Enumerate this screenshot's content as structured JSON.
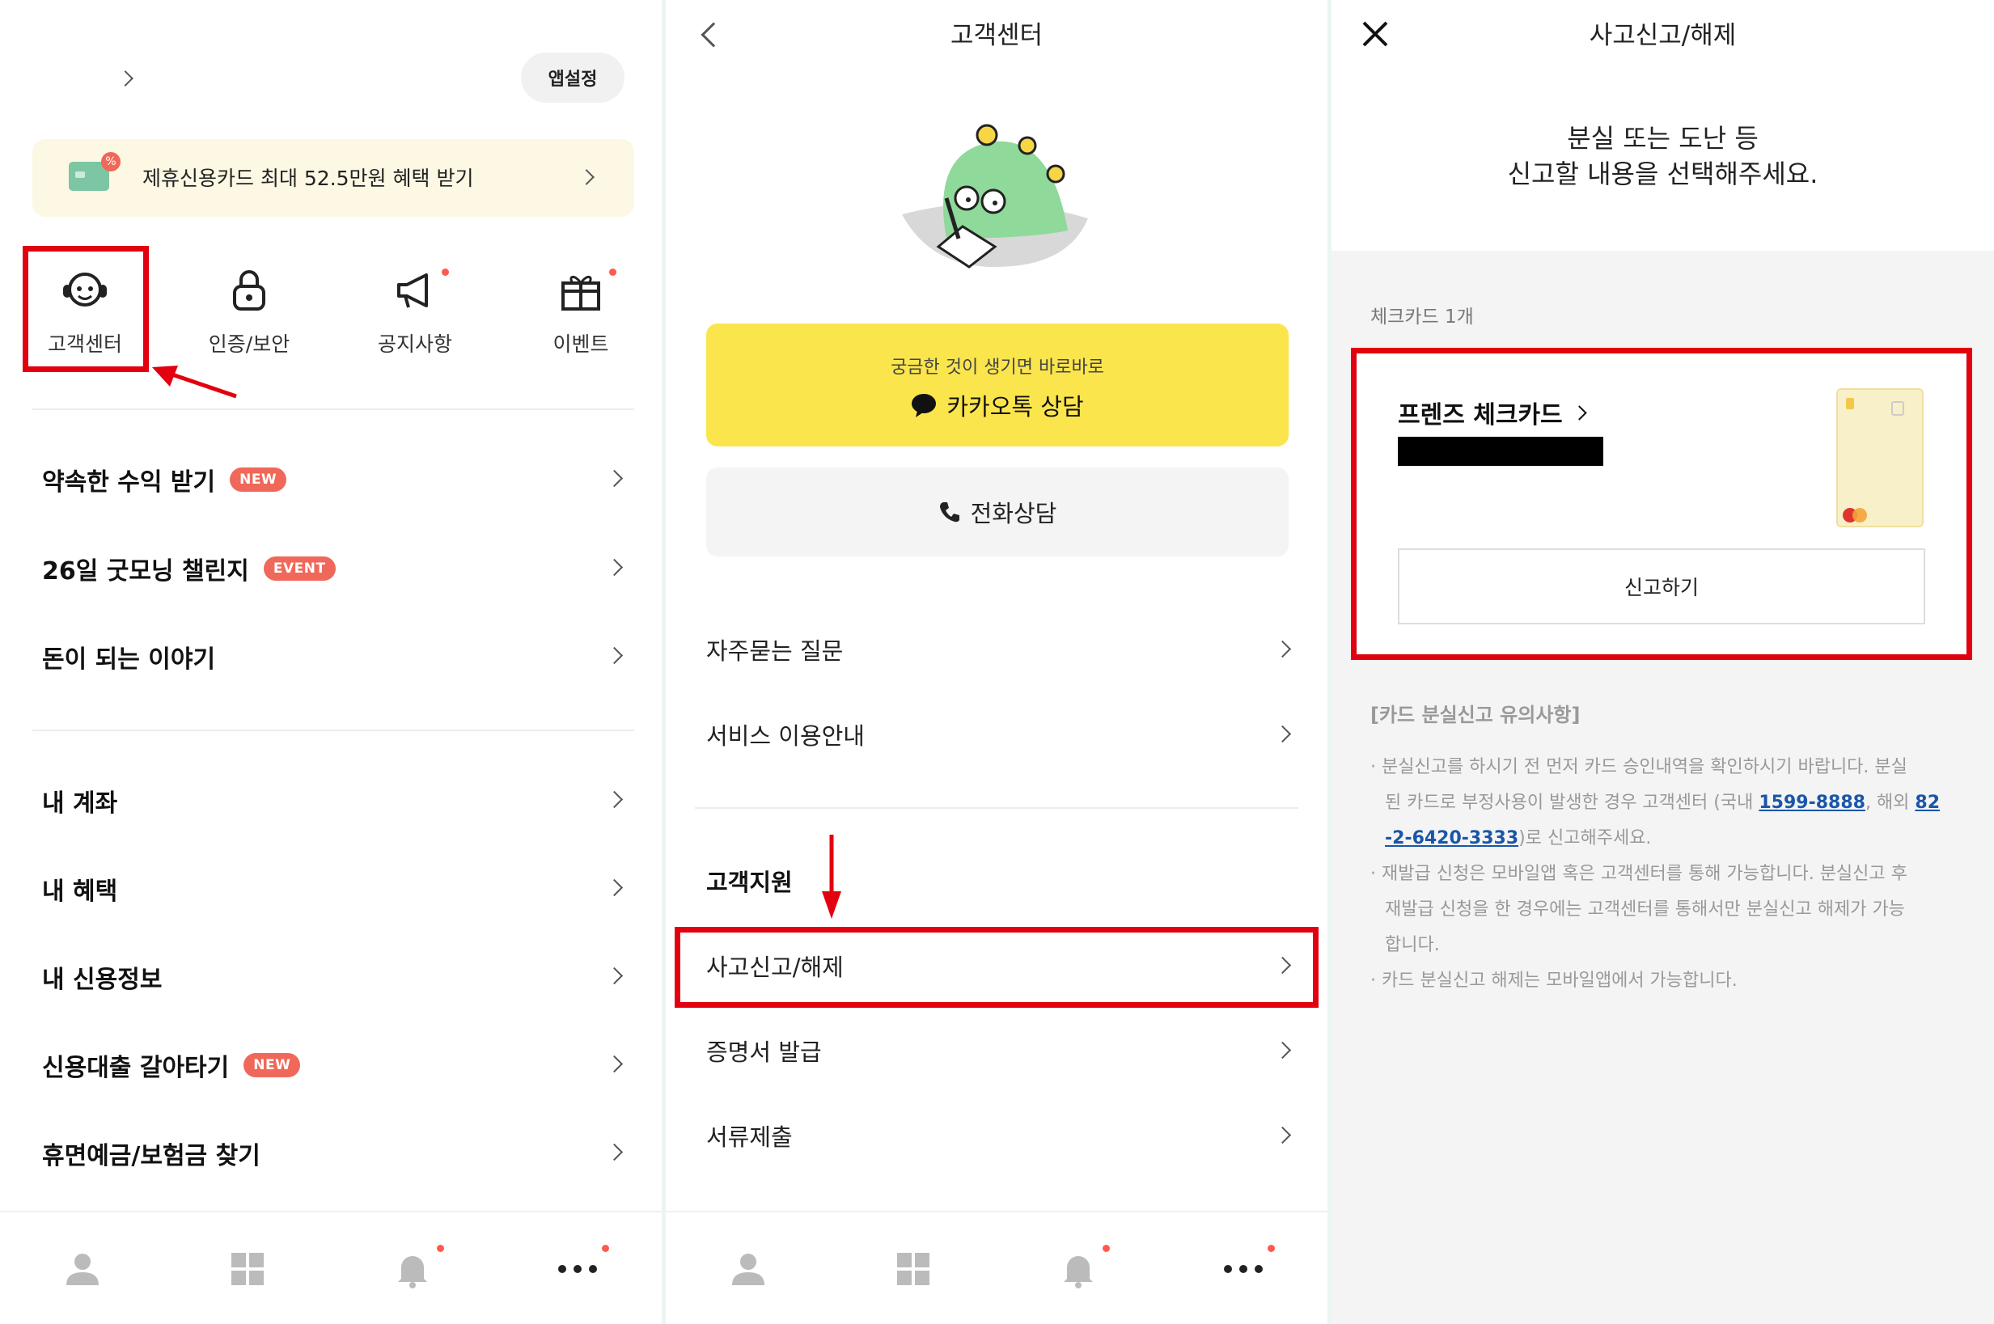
{
  "left": {
    "settings_btn": "앱설정",
    "promo_text": "제휴신용카드 최대 52.5만원 혜택 받기",
    "quick": [
      {
        "label": "고객센터",
        "icon": "headset-icon"
      },
      {
        "label": "인증/보안",
        "icon": "lock-icon"
      },
      {
        "label": "공지사항",
        "icon": "megaphone-icon"
      },
      {
        "label": "이벤트",
        "icon": "gift-icon"
      }
    ],
    "menu_a": [
      {
        "label": "약속한 수익 받기",
        "badge": "NEW"
      },
      {
        "label": "26일 굿모닝 챌린지",
        "badge": "EVENT"
      },
      {
        "label": "돈이 되는 이야기",
        "badge": ""
      }
    ],
    "menu_b": [
      {
        "label": "내 계좌",
        "badge": ""
      },
      {
        "label": "내 혜택",
        "badge": ""
      },
      {
        "label": "내 신용정보",
        "badge": ""
      },
      {
        "label": "신용대출 갈아타기",
        "badge": "NEW"
      },
      {
        "label": "휴면예금/보험금 찾기",
        "badge": ""
      }
    ]
  },
  "middle": {
    "title": "고객센터",
    "kakao_sub": "궁금한 것이 생기면 바로바로",
    "kakao_main": "카카오톡 상담",
    "phone_label": "전화상담",
    "menu_a": [
      "자주묻는 질문",
      "서비스 이용안내"
    ],
    "section_title": "고객지원",
    "menu_b": [
      "사고신고/해제",
      "증명서 발급",
      "서류제출"
    ]
  },
  "right": {
    "title": "사고신고/해제",
    "heading_line1": "분실 또는 도난 등",
    "heading_line2": "신고할 내용을 선택해주세요.",
    "count_label": "체크카드 1개",
    "card_name": "프렌즈 체크카드",
    "report_btn": "신고하기",
    "notice_title": "[카드 분실신고 유의사항]",
    "notice": {
      "n1a": "· 분실신고를 하시기 전 먼저 카드 승인내역을 확인하시기 바랍니다. 분실",
      "n1b": "된 카드로 부정사용이 발생한 경우 고객센터 (국내 ",
      "phone_domestic": "1599-8888",
      "n1c": ", 해외 ",
      "phone_intl_a": "82",
      "phone_intl_b": "-2-6420-3333",
      "n1d": ")로 신고해주세요.",
      "n2a": "· 재발급 신청은 모바일앱 혹은 고객센터를 통해 가능합니다. 분실신고 후",
      "n2b": "재발급 신청을 한 경우에는 고객센터를 통해서만 분실신고 해제가 가능",
      "n2c": "합니다.",
      "n3": "· 카드 분실신고 해제는 모바일앱에서 가능합니다."
    }
  },
  "colors": {
    "accent_red": "#e3000f",
    "kakao_yellow": "#fae54d",
    "badge_red": "#f0685a",
    "link_blue": "#1a56a8"
  }
}
